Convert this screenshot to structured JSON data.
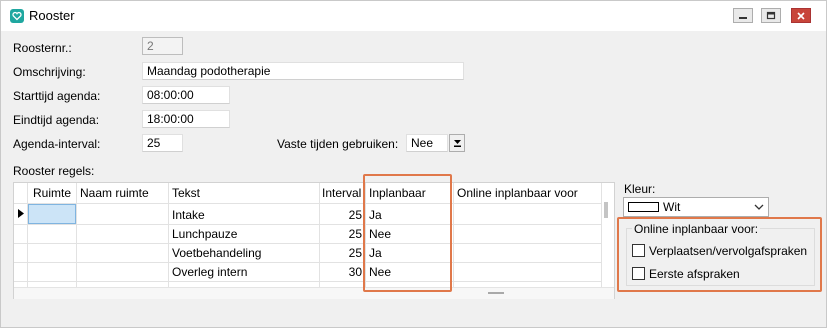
{
  "window": {
    "title": "Rooster",
    "controls": {
      "minimize": "minimize",
      "maximize": "maximize",
      "close": "close"
    }
  },
  "form": {
    "roosternr": {
      "label": "Roosternr.:",
      "value": "2"
    },
    "omschrijving": {
      "label": "Omschrijving:",
      "value": "Maandag podotherapie"
    },
    "starttijd": {
      "label": "Starttijd agenda:",
      "value": "08:00:00"
    },
    "eindtijd": {
      "label": "Eindtijd agenda:",
      "value": "18:00:00"
    },
    "interval": {
      "label": "Agenda-interval:",
      "value": "25"
    },
    "vaste_tijden": {
      "label": "Vaste tijden gebruiken:",
      "value": "Nee"
    },
    "rooster_regels_label": "Rooster regels:"
  },
  "table": {
    "columns": [
      "Ruimte",
      "Naam ruimte",
      "Tekst",
      "Interval",
      "Inplanbaar",
      "Online inplanbaar voor"
    ],
    "rows": [
      {
        "ruimte": "",
        "naam_ruimte": "",
        "tekst": "Intake",
        "interval": "25",
        "inplanbaar": "Ja"
      },
      {
        "ruimte": "",
        "naam_ruimte": "",
        "tekst": "Lunchpauze",
        "interval": "25",
        "inplanbaar": "Nee"
      },
      {
        "ruimte": "",
        "naam_ruimte": "",
        "tekst": "Voetbehandeling",
        "interval": "25",
        "inplanbaar": "Ja"
      },
      {
        "ruimte": "",
        "naam_ruimte": "",
        "tekst": "Overleg intern",
        "interval": "30",
        "inplanbaar": "Nee"
      }
    ]
  },
  "sidepanel": {
    "kleur_label": "Kleur:",
    "kleur_value": "Wit",
    "online_group_label": "Online inplanbaar voor:",
    "checkbox_verplaatsen": {
      "label": "Verplaatsen/vervolgafspraken",
      "checked": false
    },
    "checkbox_eerste": {
      "label": "Eerste afspraken",
      "checked": false
    }
  },
  "colors": {
    "highlight": "#e0784a",
    "app_icon": "#1fa7a0",
    "selected_cell": "#cce4f7",
    "close_button": "#c8453a"
  },
  "icons": {
    "app": "heart-icon",
    "dropdown": "download-arrow-icon",
    "row_indicator": "triangle-right-icon",
    "color_dropdown": "chevron-down-icon"
  }
}
